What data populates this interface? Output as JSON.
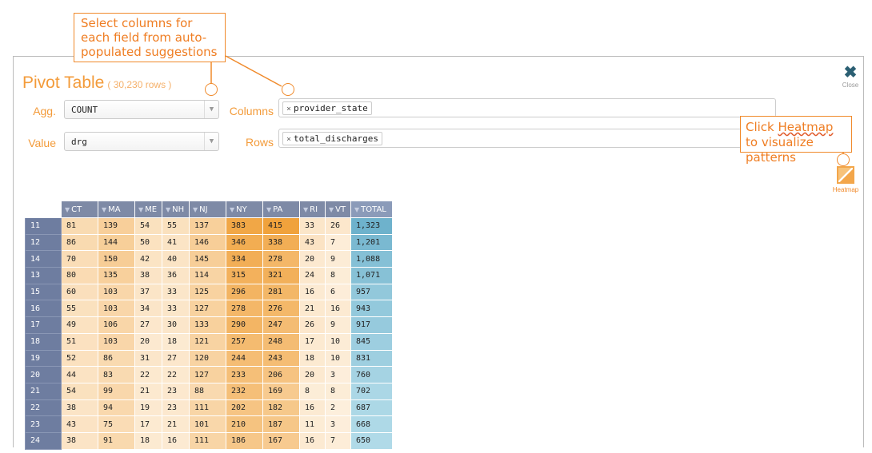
{
  "callouts": {
    "top": "Select columns for each field from auto-populated suggestions",
    "right_prefix": "Click ",
    "right_link": "Heatmap",
    "right_suffix": " to visualize patterns"
  },
  "panel": {
    "title": "Pivot Table",
    "row_count": "( 30,230 rows )",
    "close_label": "Close",
    "heatmap_label": "Heatmap"
  },
  "controls": {
    "agg_label": "Agg.",
    "agg_value": "COUNT",
    "value_label": "Value",
    "value_value": "drg",
    "columns_label": "Columns",
    "columns_tag": "provider_state",
    "rows_label": "Rows",
    "rows_tag": "total_discharges",
    "tag_remove": "×"
  },
  "colors": {
    "accent": "#f39b3a",
    "header": "#7e8aa6",
    "total": "#8cc3d6"
  },
  "table": {
    "columns": [
      "CT",
      "MA",
      "ME",
      "NH",
      "NJ",
      "NY",
      "PA",
      "RI",
      "VT",
      "TOTAL"
    ],
    "rows": [
      {
        "key": "11",
        "values": [
          "81",
          "139",
          "54",
          "55",
          "137",
          "383",
          "415",
          "33",
          "26",
          "1,323"
        ]
      },
      {
        "key": "12",
        "values": [
          "86",
          "144",
          "50",
          "41",
          "146",
          "346",
          "338",
          "43",
          "7",
          "1,201"
        ]
      },
      {
        "key": "14",
        "values": [
          "70",
          "150",
          "42",
          "40",
          "145",
          "334",
          "278",
          "20",
          "9",
          "1,088"
        ]
      },
      {
        "key": "13",
        "values": [
          "80",
          "135",
          "38",
          "36",
          "114",
          "315",
          "321",
          "24",
          "8",
          "1,071"
        ]
      },
      {
        "key": "15",
        "values": [
          "60",
          "103",
          "37",
          "33",
          "125",
          "296",
          "281",
          "16",
          "6",
          "957"
        ]
      },
      {
        "key": "16",
        "values": [
          "55",
          "103",
          "34",
          "33",
          "127",
          "278",
          "276",
          "21",
          "16",
          "943"
        ]
      },
      {
        "key": "17",
        "values": [
          "49",
          "106",
          "27",
          "30",
          "133",
          "290",
          "247",
          "26",
          "9",
          "917"
        ]
      },
      {
        "key": "18",
        "values": [
          "51",
          "103",
          "20",
          "18",
          "121",
          "257",
          "248",
          "17",
          "10",
          "845"
        ]
      },
      {
        "key": "19",
        "values": [
          "52",
          "86",
          "31",
          "27",
          "120",
          "244",
          "243",
          "18",
          "10",
          "831"
        ]
      },
      {
        "key": "20",
        "values": [
          "44",
          "83",
          "22",
          "22",
          "127",
          "233",
          "206",
          "20",
          "3",
          "760"
        ]
      },
      {
        "key": "21",
        "values": [
          "54",
          "99",
          "21",
          "23",
          "88",
          "232",
          "169",
          "8",
          "8",
          "702"
        ]
      },
      {
        "key": "22",
        "values": [
          "38",
          "94",
          "19",
          "23",
          "111",
          "202",
          "182",
          "16",
          "2",
          "687"
        ]
      },
      {
        "key": "23",
        "values": [
          "43",
          "75",
          "17",
          "21",
          "101",
          "210",
          "187",
          "11",
          "3",
          "668"
        ]
      },
      {
        "key": "24",
        "values": [
          "38",
          "91",
          "18",
          "16",
          "111",
          "186",
          "167",
          "16",
          "7",
          "650"
        ]
      }
    ]
  }
}
